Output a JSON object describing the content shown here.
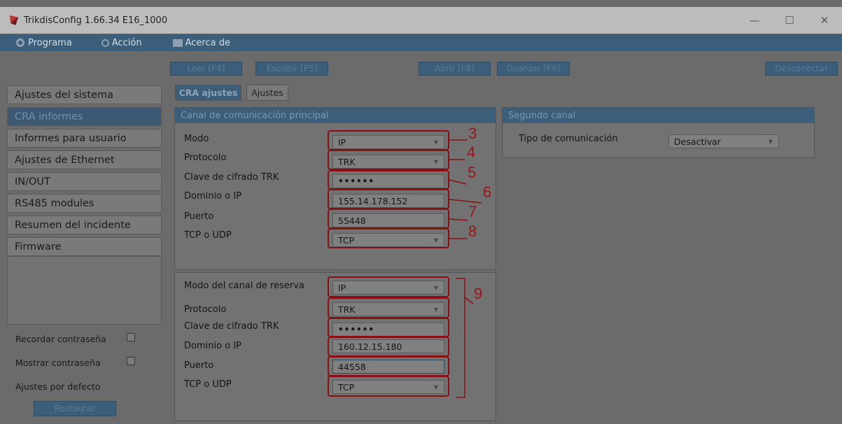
{
  "window": {
    "title": "TrikdisConfig 1.66.34   E16_1000",
    "controls": {
      "minimize": "—",
      "maximize": "☐",
      "close": "✕"
    }
  },
  "menu": {
    "programa": "Programa",
    "accion": "Acción",
    "acerca": "Acerca de"
  },
  "toolbar": {
    "leer": "Leer [F4]",
    "escribir": "Escribir [F5]",
    "abrir": "Abrir [F8]",
    "guardar": "Guardar [F9]",
    "desconectar": "Desconectar"
  },
  "sidebar": {
    "items": [
      "Ajustes del sistema",
      "CRA informes",
      "Informes para usuario",
      "Ajustes de Ethernet",
      "IN/OUT",
      "RS485 modules",
      "Resumen del incidente",
      "Firmware"
    ],
    "remember_password": "Recordar contraseña",
    "show_password": "Mostrar contraseña",
    "defaults": "Ajustes por defecto",
    "restore": "Restaurar"
  },
  "tabs": {
    "cra": "CRA ajustes",
    "ajustes": "Ajustes"
  },
  "main_channel": {
    "header": "Canal de comunicación principal",
    "labels": {
      "modo": "Modo",
      "protocolo": "Protocolo",
      "clave": "Clave de cifrado TRK",
      "dominio": "Dominio o IP",
      "puerto": "Puerto",
      "tcp": "TCP o UDP"
    },
    "values": {
      "modo": "IP",
      "protocolo": "TRK",
      "clave": "••••••",
      "dominio": "155.14.178.152",
      "puerto": "55448",
      "tcp": "TCP"
    }
  },
  "backup_channel": {
    "labels": {
      "modo": "Modo del canal de reserva",
      "protocolo": "Protocolo",
      "clave": "Clave de cifrado TRK",
      "dominio": "Dominio o IP",
      "puerto": "Puerto",
      "tcp": "TCP o UDP"
    },
    "values": {
      "modo": "IP",
      "protocolo": "TRK",
      "clave": "••••••",
      "dominio": "160.12.15.180",
      "puerto": "44558",
      "tcp": "TCP"
    }
  },
  "second_channel": {
    "header": "Segundo canal",
    "tipo_label": "Tipo de comunicación",
    "tipo_value": "Desactivar"
  },
  "annotations": {
    "n3": "3",
    "n4": "4",
    "n5": "5",
    "n6": "6",
    "n7": "7",
    "n8": "8",
    "n9": "9"
  },
  "icons": {
    "app": "trikdis-logo-icon",
    "programa": "gear-icon",
    "accion": "wrench-icon",
    "acerca": "book-icon",
    "dropdown": "chevron-down-icon"
  },
  "colors": {
    "accent": "#3b5f7a",
    "annotation": "#8b0f12",
    "background": "#6b6b6b"
  }
}
